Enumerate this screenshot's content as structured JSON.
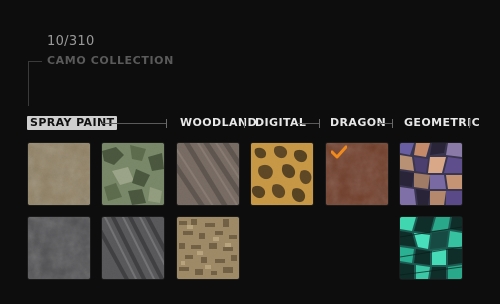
{
  "header": {
    "counter": "10/310",
    "title": "CAMO COLLECTION"
  },
  "tabs": [
    {
      "label": "SPRAY PAINT",
      "active": true
    },
    {
      "label": "WOODLAND",
      "active": false
    },
    {
      "label": "DIGITAL",
      "active": false
    },
    {
      "label": "DRAGON",
      "active": false
    },
    {
      "label": "GEOMETRIC",
      "active": false
    }
  ],
  "camos": [
    {
      "category": "SPRAY PAINT",
      "pattern": "spray-tan",
      "equipped": false
    },
    {
      "category": "SPRAY PAINT",
      "pattern": "spray-dark",
      "equipped": false
    },
    {
      "category": "WOODLAND",
      "pattern": "woodland-green",
      "equipped": false
    },
    {
      "category": "WOODLAND",
      "pattern": "woodland-stripes",
      "equipped": false
    },
    {
      "category": "DIGITAL",
      "pattern": "digital-sand-stripes",
      "equipped": false
    },
    {
      "category": "DIGITAL",
      "pattern": "digital-desert",
      "equipped": false
    },
    {
      "category": "DRAGON",
      "pattern": "dragon-leopard",
      "equipped": false
    },
    {
      "category": "DRAGON",
      "pattern": "dragon-rust",
      "equipped": true
    },
    {
      "category": "GEOMETRIC",
      "pattern": "geometric-shards",
      "equipped": false
    },
    {
      "category": "GEOMETRIC",
      "pattern": "geometric-teal",
      "equipped": false
    }
  ],
  "colors": {
    "active_tab_bg": "#cfcfcf",
    "equipped_check": "#f08a1c",
    "background": "#0d0d0d"
  }
}
